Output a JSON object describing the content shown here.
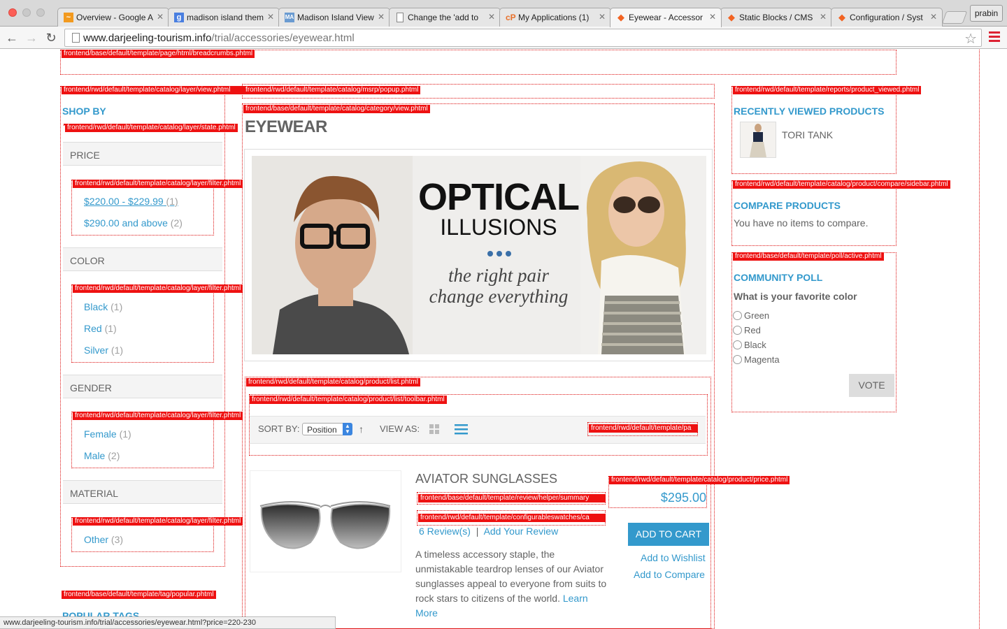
{
  "browser": {
    "tabs": [
      {
        "title": "Overview - Google A",
        "favicon": "chart-icon",
        "active": false
      },
      {
        "title": "madison island them",
        "favicon": "google-icon",
        "active": false
      },
      {
        "title": "Madison Island View",
        "favicon": "ma-icon",
        "active": false
      },
      {
        "title": "Change the 'add to",
        "favicon": "page-icon",
        "active": false
      },
      {
        "title": "My Applications (1)",
        "favicon": "cpanel-icon",
        "active": false
      },
      {
        "title": "Eyewear - Accessor",
        "favicon": "magento-icon",
        "active": true
      },
      {
        "title": "Static Blocks / CMS",
        "favicon": "magento-icon",
        "active": false
      },
      {
        "title": "Configuration / Syst",
        "favicon": "magento-icon",
        "active": false
      }
    ],
    "profile": "prabin",
    "url_host": "www.darjeeling-tourism.info",
    "url_path": "/trial/accessories/eyewear.html",
    "status_url": "www.darjeeling-tourism.info/trial/accessories/eyewear.html?price=220-230"
  },
  "hints": {
    "breadcrumbs": "frontend/base/default/template/page/html/breadcrumbs.phtml",
    "layer_view": "frontend/rwd/default/template/catalog/layer/view.phtml",
    "msrp_popup": "frontend/rwd/default/template/catalog/msrp/popup.phtml",
    "category_view": "frontend/base/default/template/catalog/category/view.phtml",
    "layer_state": "frontend/rwd/default/template/catalog/layer/state.phtml",
    "filter_1": "frontend/rwd/default/template/catalog/layer/filter.phtml",
    "filter_2": "frontend/rwd/default/template/catalog/layer/filter.phtml",
    "filter_3": "frontend/rwd/default/template/catalog/layer/filter.phtml",
    "filter_4": "frontend/rwd/default/template/catalog/layer/filter.phtml",
    "product_list": "frontend/rwd/default/template/catalog/product/list.phtml",
    "toolbar": "frontend/rwd/default/template/catalog/product/list/toolbar.phtml",
    "pager": "frontend/rwd/default/template/pa",
    "price": "frontend/rwd/default/template/catalog/product/price.phtml",
    "review_summary": "frontend/base/default/template/review/helper/summary",
    "swatches": "frontend/rwd/default/template/configurableswatches/ca",
    "tag_popular": "frontend/base/default/template/tag/popular.phtml",
    "product_viewed": "frontend/rwd/default/template/reports/product_viewed.phtml",
    "compare_sidebar": "frontend/rwd/default/template/catalog/product/compare/sidebar.phtml",
    "poll_active": "frontend/base/default/template/poll/active.phtml"
  },
  "sidebar": {
    "shop_by": "SHOP BY",
    "price": {
      "heading": "PRICE",
      "items": [
        {
          "label": "$220.00 - $229.99",
          "count": "(1)"
        },
        {
          "label": "$290.00 and above",
          "count": "(2)"
        }
      ]
    },
    "color": {
      "heading": "COLOR",
      "items": [
        {
          "label": "Black",
          "count": "(1)"
        },
        {
          "label": "Red",
          "count": "(1)"
        },
        {
          "label": "Silver",
          "count": "(1)"
        }
      ]
    },
    "gender": {
      "heading": "GENDER",
      "items": [
        {
          "label": "Female",
          "count": "(1)"
        },
        {
          "label": "Male",
          "count": "(2)"
        }
      ]
    },
    "material": {
      "heading": "MATERIAL",
      "items": [
        {
          "label": "Other",
          "count": "(3)"
        }
      ]
    },
    "popular_tags": "POPULAR TAGS"
  },
  "main": {
    "category_title": "EYEWEAR",
    "banner": {
      "headline_1": "OPTICAL",
      "headline_2": "ILLUSIONS",
      "tagline_1": "the right pair",
      "tagline_2": "change everything"
    },
    "toolbar": {
      "sort_by_label": "SORT BY:",
      "sort_value": "Position",
      "view_as_label": "VIEW AS:"
    },
    "product": {
      "name": "AVIATOR SUNGLASSES",
      "price": "$295.00",
      "reviews": "6 Review(s)",
      "separator": "|",
      "add_review": "Add Your Review",
      "add_to_cart": "ADD TO CART",
      "wishlist": "Add to Wishlist",
      "compare": "Add to Compare",
      "description": "A timeless accessory staple, the unmistakable teardrop lenses of our Aviator sunglasses appeal to everyone from suits to rock stars to citizens of the world.",
      "learn_more": "Learn More"
    }
  },
  "right": {
    "recently_viewed": "RECENTLY VIEWED PRODUCTS",
    "recent_item": "TORI TANK",
    "compare_title": "COMPARE PRODUCTS",
    "compare_empty": "You have no items to compare.",
    "poll_title": "COMMUNITY POLL",
    "poll_question": "What is your favorite color",
    "poll_options": [
      "Green",
      "Red",
      "Black",
      "Magenta"
    ],
    "vote": "VOTE"
  },
  "colors": {
    "accent": "#3399cc",
    "hint_red": "#ee1111",
    "text": "#636363"
  }
}
